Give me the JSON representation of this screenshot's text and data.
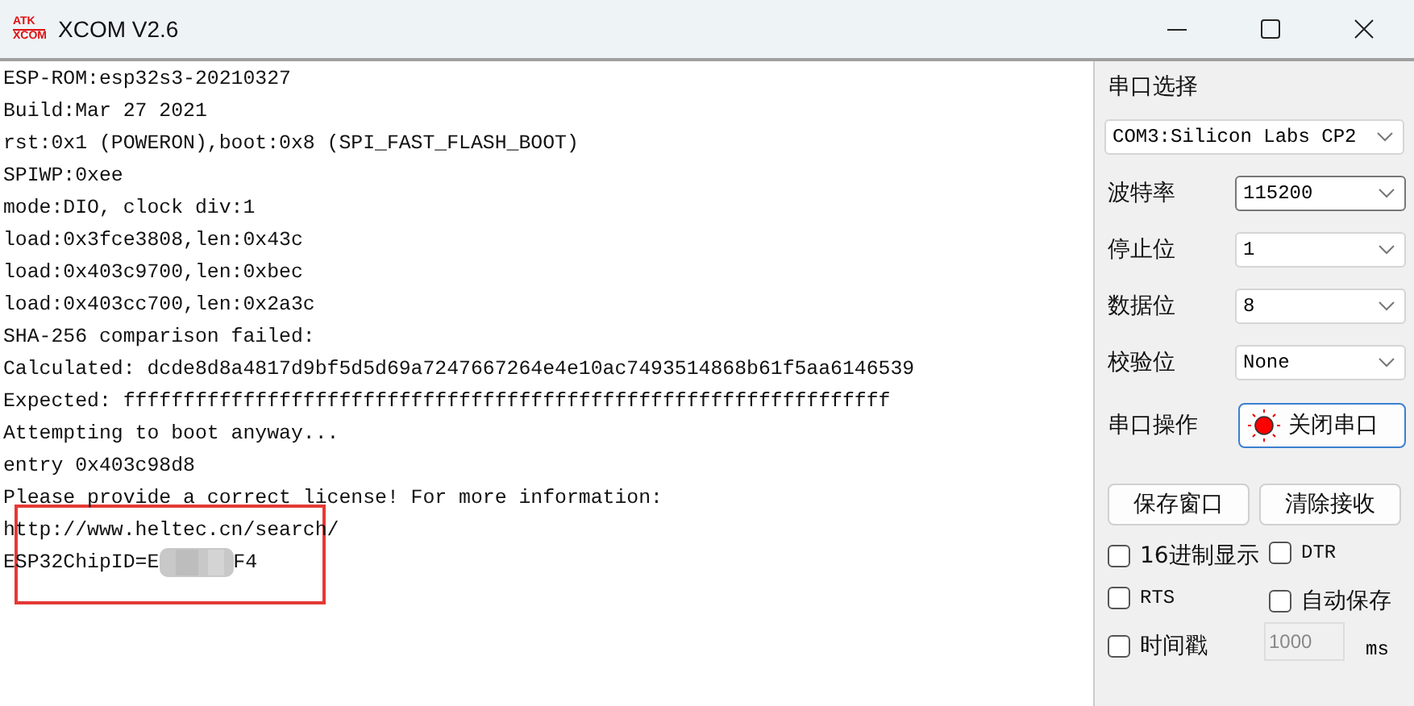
{
  "window": {
    "title": "XCOM V2.6",
    "logo_top": "ATK",
    "logo_bottom": "XCOM"
  },
  "log": {
    "lines": [
      "ESP-ROM:esp32s3-20210327",
      "Build:Mar 27 2021",
      "rst:0x1 (POWERON),boot:0x8 (SPI_FAST_FLASH_BOOT)",
      "SPIWP:0xee",
      "mode:DIO, clock div:1",
      "load:0x3fce3808,len:0x43c",
      "load:0x403c9700,len:0xbec",
      "load:0x403cc700,len:0x2a3c",
      "SHA-256 comparison failed:",
      "Calculated: dcde8d8a4817d9bf5d5d69a7247667264e4e10ac7493514868b61f5aa6146539",
      "Expected: ffffffffffffffffffffffffffffffffffffffffffffffffffffffffffffffff",
      "Attempting to boot anyway...",
      "entry 0x403c98d8",
      "Please provide a correct license! For more information:",
      "http://www.heltec.cn/search/"
    ],
    "chip_id": {
      "head": "ESP32ChipID=E",
      "tail": "F4"
    }
  },
  "panel": {
    "port_label": "串口选择",
    "port_value": "COM3:Silicon Labs CP2",
    "settings": [
      {
        "label": "波特率",
        "value": "115200",
        "focused": true
      },
      {
        "label": "停止位",
        "value": "1",
        "focused": false
      },
      {
        "label": "数据位",
        "value": "8",
        "focused": false
      },
      {
        "label": "校验位",
        "value": "None",
        "focused": false
      }
    ],
    "operation_label": "串口操作",
    "operation_button": {
      "label": "关闭串口",
      "open": true
    },
    "buttons": [
      "保存窗口",
      "清除接收"
    ],
    "checkboxes": [
      {
        "label": "16进制显示",
        "checked": false
      },
      {
        "label": "DTR",
        "checked": false
      },
      {
        "label": "RTS",
        "checked": false
      },
      {
        "label": "自动保存",
        "checked": false
      },
      {
        "label": "时间戳",
        "checked": false
      }
    ],
    "interval": {
      "placeholder": "1000",
      "unit": "ms"
    }
  }
}
